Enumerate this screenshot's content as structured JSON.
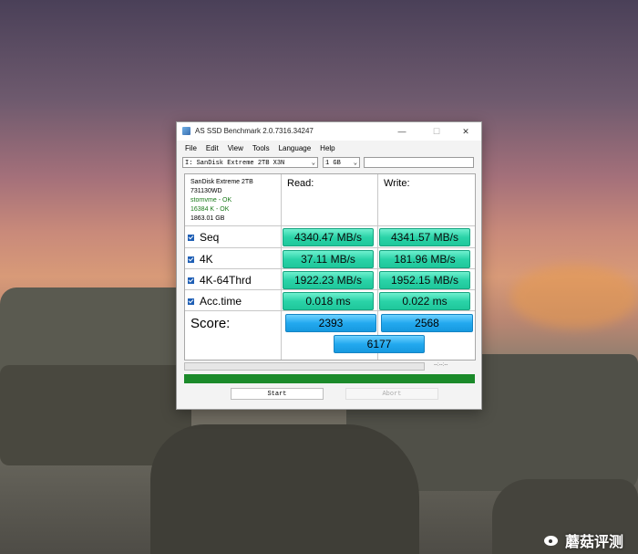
{
  "window": {
    "title": "AS SSD Benchmark 2.0.7316.34247",
    "minimize": "—",
    "maximize": "☐",
    "close": "✕"
  },
  "menu": [
    "File",
    "Edit",
    "View",
    "Tools",
    "Language",
    "Help"
  ],
  "toolbar": {
    "drive": "I: SanDisk Extreme 2TB X3N",
    "size": "1 GB"
  },
  "drive_info": {
    "name": "SanDisk Extreme 2TB",
    "firmware": "731130WD",
    "driver": "stornvme - OK",
    "alignment": "16384 K - OK",
    "capacity": "1863.01 GB"
  },
  "columns": {
    "read": "Read:",
    "write": "Write:"
  },
  "rows": [
    {
      "label": "Seq",
      "read": "4340.47 MB/s",
      "write": "4341.57 MB/s"
    },
    {
      "label": "4K",
      "read": "37.11 MB/s",
      "write": "181.96 MB/s"
    },
    {
      "label": "4K-64Thrd",
      "read": "1922.23 MB/s",
      "write": "1952.15 MB/s"
    },
    {
      "label": "Acc.time",
      "read": "0.018 ms",
      "write": "0.022 ms"
    }
  ],
  "score": {
    "label": "Score:",
    "read": "2393",
    "write": "2568",
    "total": "6177"
  },
  "progress": {
    "time": "--:--:--",
    "complete_fraction": 1.0
  },
  "buttons": {
    "start": "Start",
    "abort": "Abort"
  },
  "watermark": {
    "text": "蘑菇评测"
  },
  "colors": {
    "value_box": "#2ad3a8",
    "score_box": "#23a9ef",
    "progress": "#1b8a2a"
  }
}
